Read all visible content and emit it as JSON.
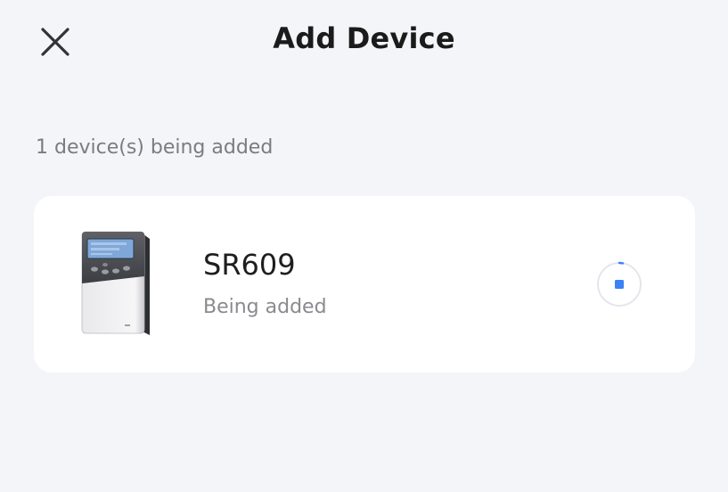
{
  "header": {
    "title": "Add Device",
    "close_icon": "close-icon"
  },
  "status_summary": "1 device(s) being added",
  "devices": [
    {
      "name": "SR609",
      "status": "Being added",
      "image_icon": "solar-controller-device-image",
      "progress_icon": "loading-stop-icon"
    }
  ],
  "colors": {
    "background": "#f4f5f9",
    "card": "#ffffff",
    "accent": "#3b82f6",
    "secondary_text": "#8a8a8f"
  }
}
